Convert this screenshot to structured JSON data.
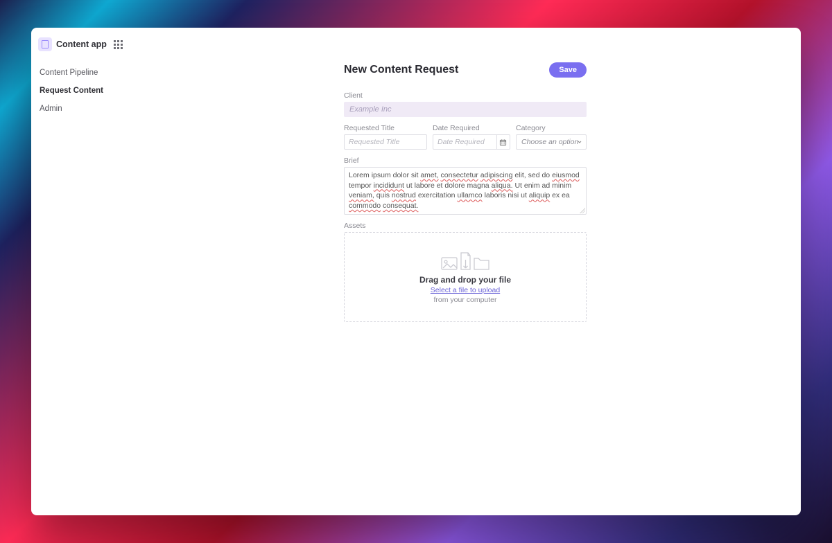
{
  "app": {
    "title": "Content app"
  },
  "sidebar": {
    "items": [
      {
        "label": "Content Pipeline",
        "active": false
      },
      {
        "label": "Request Content",
        "active": true
      },
      {
        "label": "Admin",
        "active": false
      }
    ]
  },
  "page": {
    "title": "New Content Request",
    "save_label": "Save"
  },
  "form": {
    "client_label": "Client",
    "client_placeholder": "Example Inc",
    "title_label": "Requested Title",
    "title_placeholder": "Requested Title",
    "date_label": "Date Required",
    "date_placeholder": "Date Required",
    "category_label": "Category",
    "category_placeholder": "Choose an option",
    "brief_label": "Brief",
    "brief_text": "Lorem ipsum dolor sit amet, consectetur adipiscing elit, sed do eiusmod tempor incididunt ut labore et dolore magna aliqua. Ut enim ad minim veniam, quis nostrud exercitation ullamco laboris nisi ut aliquip ex ea commodo consequat.",
    "brief_spellcheck_words": [
      "amet",
      "consectetur",
      "adipiscing",
      "eiusmod",
      "incididunt",
      "aliqua",
      "veniam",
      "nostrud",
      "ullamco",
      "aliquip",
      "commodo",
      "consequat"
    ],
    "assets_label": "Assets",
    "dropzone": {
      "title": "Drag and drop your file",
      "link": "Select a file to upload",
      "sub": "from your computer"
    }
  }
}
